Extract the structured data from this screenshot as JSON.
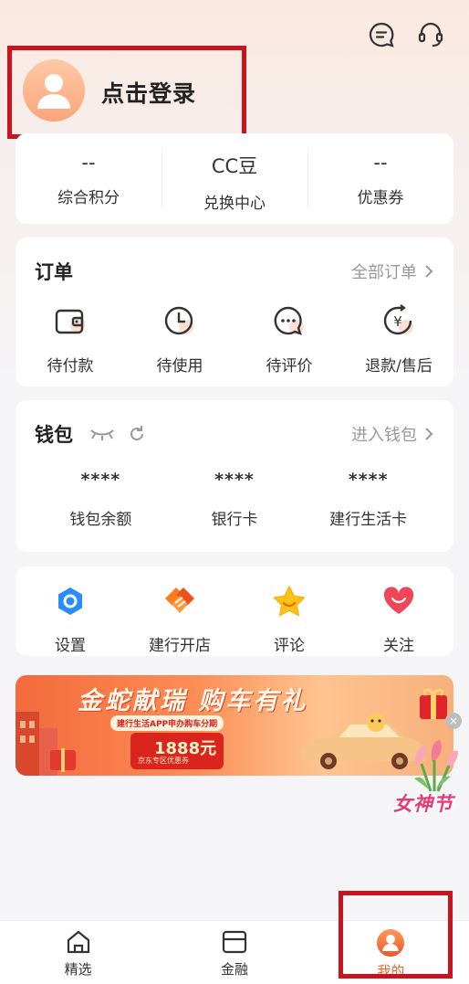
{
  "header": {
    "login_label": "点击登录"
  },
  "stats": [
    {
      "value": "--",
      "label": "综合积分"
    },
    {
      "value": "CC豆",
      "label": "兑换中心"
    },
    {
      "value": "--",
      "label": "优惠券"
    }
  ],
  "orders": {
    "title": "订单",
    "link": "全部订单",
    "items": [
      {
        "label": "待付款",
        "icon": "wallet-icon"
      },
      {
        "label": "待使用",
        "icon": "clock-icon"
      },
      {
        "label": "待评价",
        "icon": "chat-icon"
      },
      {
        "label": "退款/售后",
        "icon": "refund-icon"
      }
    ]
  },
  "wallet": {
    "title": "钱包",
    "link": "进入钱包",
    "items": [
      {
        "value": "****",
        "label": "钱包余额"
      },
      {
        "value": "****",
        "label": "银行卡"
      },
      {
        "value": "****",
        "label": "建行生活卡"
      }
    ]
  },
  "tools": [
    {
      "label": "设置",
      "icon": "settings-icon"
    },
    {
      "label": "建行开店",
      "icon": "shop-icon"
    },
    {
      "label": "评论",
      "icon": "star-icon"
    },
    {
      "label": "关注",
      "icon": "heart-icon"
    }
  ],
  "banner": {
    "title": "金蛇献瑞 购车有礼",
    "subtitle": "建行生活APP申办购车分期",
    "amount": "1888元",
    "note": "京东专区优惠券"
  },
  "float_badge": "女神节",
  "tabs": [
    {
      "label": "精选",
      "icon": "home-icon"
    },
    {
      "label": "金融",
      "icon": "card-icon"
    },
    {
      "label": "我的",
      "icon": "profile-icon"
    }
  ],
  "colors": {
    "accent": "#f0652d",
    "highlight_box": "#c8141e"
  }
}
